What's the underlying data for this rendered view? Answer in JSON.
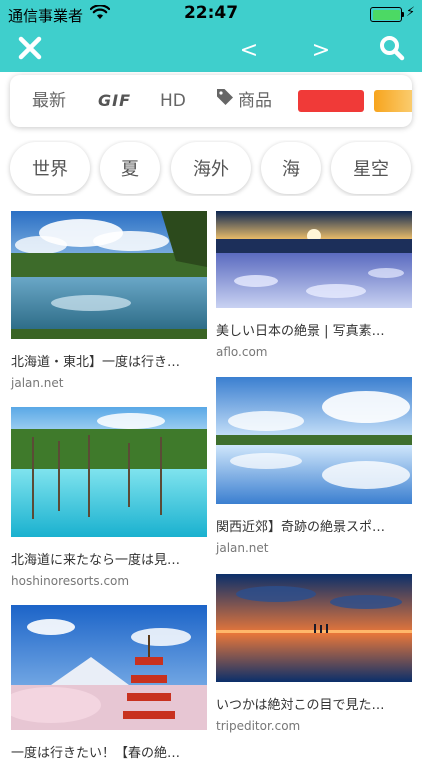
{
  "status_bar": {
    "carrier": "通信事業者",
    "time": "22:47"
  },
  "nav": {
    "close_icon": "close-x-icon",
    "prev_label": "<",
    "next_label": ">",
    "search_icon": "search-icon"
  },
  "filters": {
    "latest": "最新",
    "gif": "GIF",
    "hd": "HD",
    "product": "商品",
    "product_icon": "tag-icon",
    "color_swatches": [
      "#f03a38",
      "#f7a41d"
    ]
  },
  "chips": [
    "世界",
    "夏",
    "海外",
    "海",
    "星空"
  ],
  "results": [
    {
      "title": "北海道・東北】一度は行き…",
      "source": "jalan.net"
    },
    {
      "title": "美しい日本の絶景 | 写真素…",
      "source": "aflo.com"
    },
    {
      "title": "北海道に来たなら一度は見…",
      "source": "hoshinoresorts.com"
    },
    {
      "title": "関西近郊】奇跡の絶景スポ…",
      "source": "jalan.net"
    },
    {
      "title": "一度は行きたい！【春の絶…",
      "source": ""
    },
    {
      "title": "いつかは絶対この目で見た…",
      "source": "tripeditor.com"
    }
  ]
}
